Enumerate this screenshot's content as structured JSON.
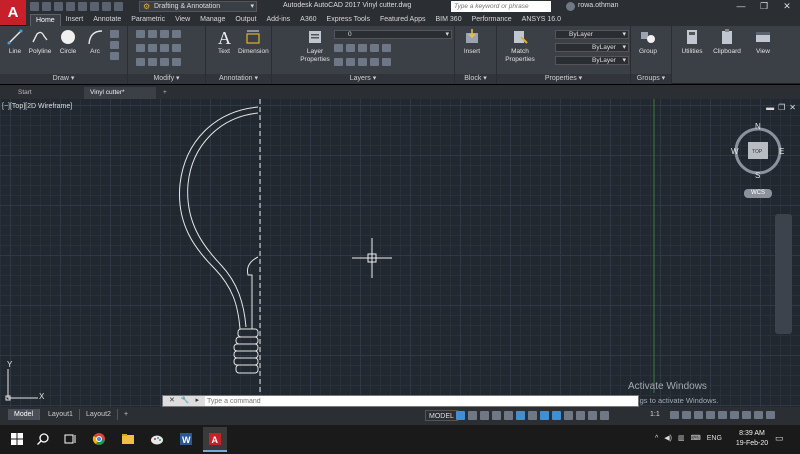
{
  "titlebar": {
    "app_icon_letter": "A",
    "workspace": "Drafting & Annotation",
    "title": "Autodesk AutoCAD 2017    Vinyl cutter.dwg",
    "search_placeholder": "Type a keyword or phrase",
    "user": "rowa.othman",
    "minimize": "—",
    "restore": "❐",
    "close": "✕"
  },
  "ribbon_tabs": [
    "Home",
    "Insert",
    "Annotate",
    "Parametric",
    "View",
    "Manage",
    "Output",
    "Add-ins",
    "A360",
    "Express Tools",
    "Featured Apps",
    "BIM 360",
    "Performance",
    "ANSYS 16.0"
  ],
  "ribbon": {
    "draw": {
      "label": "Draw ▾",
      "tools": [
        "Line",
        "Polyline",
        "Circle",
        "Arc"
      ]
    },
    "modify": {
      "label": "Modify ▾"
    },
    "annotation": {
      "label": "Annotation ▾",
      "tools": [
        "Text",
        "Dimension"
      ]
    },
    "layers": {
      "label": "Layers ▾",
      "tool": "Layer\nProperties",
      "current_layer": "0"
    },
    "block": {
      "label": "Block ▾",
      "tool": "Insert"
    },
    "properties": {
      "label": "Properties ▾",
      "tool": "Match\nProperties",
      "color": "ByLayer",
      "linetype": "ByLayer",
      "lineweight": "ByLayer"
    },
    "groups": {
      "label": "Groups ▾",
      "tool": "Group"
    },
    "utilities": "Utilities",
    "clipboard": "Clipboard",
    "view": "View"
  },
  "file_tabs": [
    "Start",
    "Vinyl cutter*"
  ],
  "drawing": {
    "viewport_label": "[−][Top][2D Wireframe]",
    "compass": {
      "n": "N",
      "s": "S",
      "e": "E",
      "w": "W",
      "top": "TOP"
    },
    "wcs": "WCS",
    "ucs_x": "X",
    "ucs_y": "Y"
  },
  "watermark": {
    "title": "Activate Windows",
    "subtitle": "Go to Settings to activate Windows."
  },
  "command_line": {
    "placeholder": "Type a command"
  },
  "layout_tabs": [
    "Model",
    "Layout1",
    "Layout2"
  ],
  "status": {
    "model": "MODEL",
    "scale": "1:1"
  },
  "taskbar": {
    "language": "ENG",
    "time": "8:39 AM",
    "date": "19-Feb-20"
  },
  "colors": {
    "accent": "#c8202a",
    "active_toggle": "#3d8fd6",
    "canvas": "#212830"
  }
}
